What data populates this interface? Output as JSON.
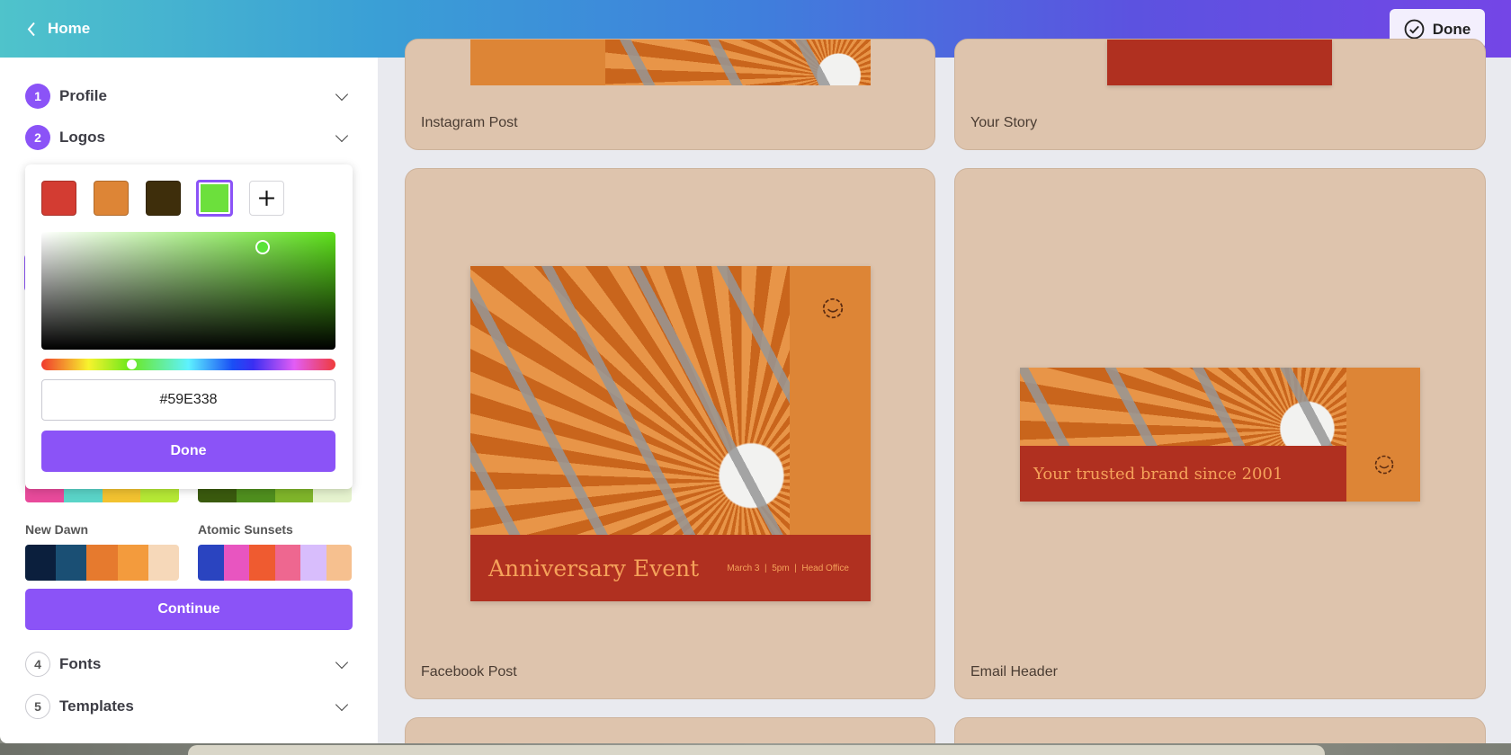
{
  "header": {
    "back_label": "Home",
    "done_label": "Done"
  },
  "steps": [
    {
      "number": "1",
      "label": "Profile"
    },
    {
      "number": "2",
      "label": "Logos"
    },
    {
      "number": "4",
      "label": "Fonts"
    },
    {
      "number": "5",
      "label": "Templates"
    }
  ],
  "color_picker": {
    "swatches": [
      "#D33C32",
      "#DD8536",
      "#3E2E0B",
      "#6CE03C"
    ],
    "selected_swatch": 3,
    "add_icon": "plus-icon",
    "hue_color": "#5CE01A",
    "hex_value": "#59E338",
    "done_label": "Done"
  },
  "palettes": [
    {
      "name": "",
      "colors": [
        "#E84A9B",
        "#5AD4C8",
        "#F2C230",
        "#B5E835"
      ]
    },
    {
      "name": "",
      "colors": [
        "#3A5A0E",
        "#4F8F1E",
        "#7FB52A",
        "#E6F3CF"
      ]
    },
    {
      "name": "New Dawn",
      "colors": [
        "#0B1F3D",
        "#1A4F74",
        "#E67A2E",
        "#F39B3D",
        "#F6D8B9"
      ]
    },
    {
      "name": "Atomic Sunsets",
      "colors": [
        "#2A44C0",
        "#E855C0",
        "#EF5B30",
        "#EE6790",
        "#D8BDFC",
        "#F6C08F"
      ]
    }
  ],
  "continue_label": "Continue",
  "templates": [
    {
      "label": "Instagram Post"
    },
    {
      "label": "Your Story"
    },
    {
      "label": "Facebook Post",
      "headline": "Anniversary Event",
      "details": "March 3  |  5pm  |  Head Office"
    },
    {
      "label": "Email Header",
      "headline": "Your trusted brand since 2001"
    }
  ],
  "colors": {
    "accent": "#8B53F7",
    "brand_red": "#B03020",
    "brand_orange": "#DD8536",
    "headline_text": "#F5A25A"
  }
}
